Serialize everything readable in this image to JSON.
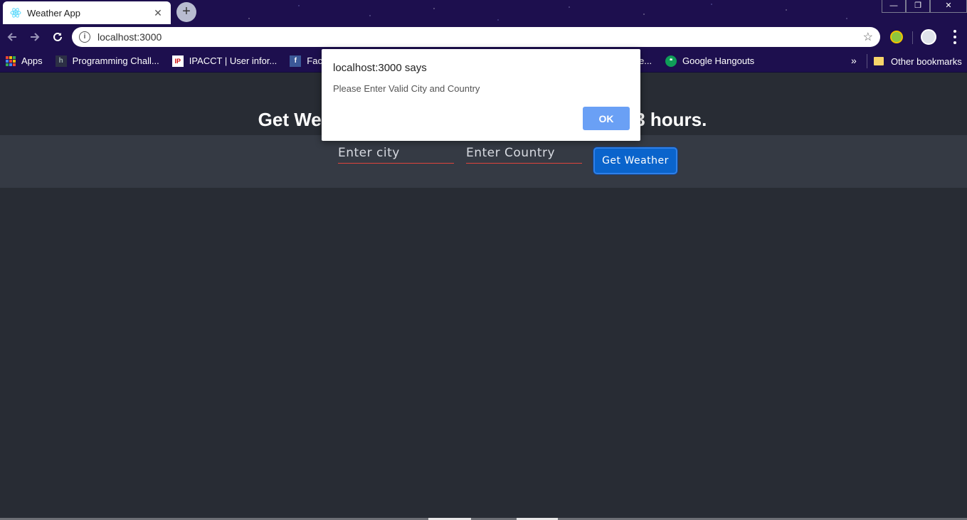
{
  "browser": {
    "tab_title": "Weather App",
    "tab_close": "✕",
    "new_tab": "+",
    "url": "localhost:3000",
    "window_controls": {
      "minimize": "—",
      "restore": "❐",
      "close": "✕"
    },
    "bookmarks": [
      {
        "label": "Apps",
        "icon": "apps-grid-icon"
      },
      {
        "label": "Programming Chall...",
        "icon": "h-icon"
      },
      {
        "label": "IPACCT | User infor...",
        "icon": "ip-icon"
      },
      {
        "label": "Faceboo",
        "icon": "facebook-icon"
      },
      {
        "label": "e...",
        "icon": ""
      },
      {
        "label": "Google Hangouts",
        "icon": "hangouts-icon"
      }
    ],
    "bookmarks_more": "»",
    "other_bookmarks": "Other bookmarks"
  },
  "page": {
    "heading_left": "Get Wea",
    "heading_right": "3 hours.",
    "city_placeholder": "Enter city",
    "country_placeholder": "Enter Country",
    "get_weather_label": "Get Weather"
  },
  "dialog": {
    "title": "localhost:3000 says",
    "message": "Please Enter Valid City and Country",
    "ok_label": "OK"
  },
  "colors": {
    "chrome_bg": "#1d0f4e",
    "page_bg": "#282c34",
    "band_bg": "#353a44",
    "field_underline": "#e0443c",
    "button_blue": "#0a64cc",
    "ok_blue": "#6aa0f5"
  }
}
